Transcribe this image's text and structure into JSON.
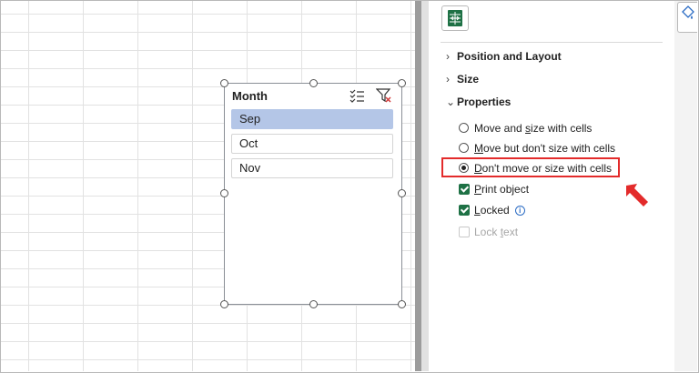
{
  "slicer": {
    "title": "Month",
    "items": [
      {
        "label": "Sep",
        "selected": true
      },
      {
        "label": "Oct",
        "selected": false
      },
      {
        "label": "Nov",
        "selected": false
      }
    ]
  },
  "pane": {
    "sections": {
      "position_layout": "Position and Layout",
      "size": "Size",
      "properties": "Properties"
    },
    "options": {
      "move_size_a": "Move and ",
      "move_size_u": "s",
      "move_size_b": "ize with cells",
      "move_only_u": "M",
      "move_only_b": "ove but don't size with cells",
      "dont_move_u": "D",
      "dont_move_b": "on't move or size with cells",
      "print_u": "P",
      "print_b": "rint object",
      "locked_u": "L",
      "locked_b": "ocked",
      "lock_text_a": "Lock ",
      "lock_text_u": "t",
      "lock_text_b": "ext"
    },
    "info_glyph": "i"
  },
  "colors": {
    "highlight": "#e32b2b",
    "check": "#1e7145",
    "slicer_selected": "#b4c6e7"
  }
}
